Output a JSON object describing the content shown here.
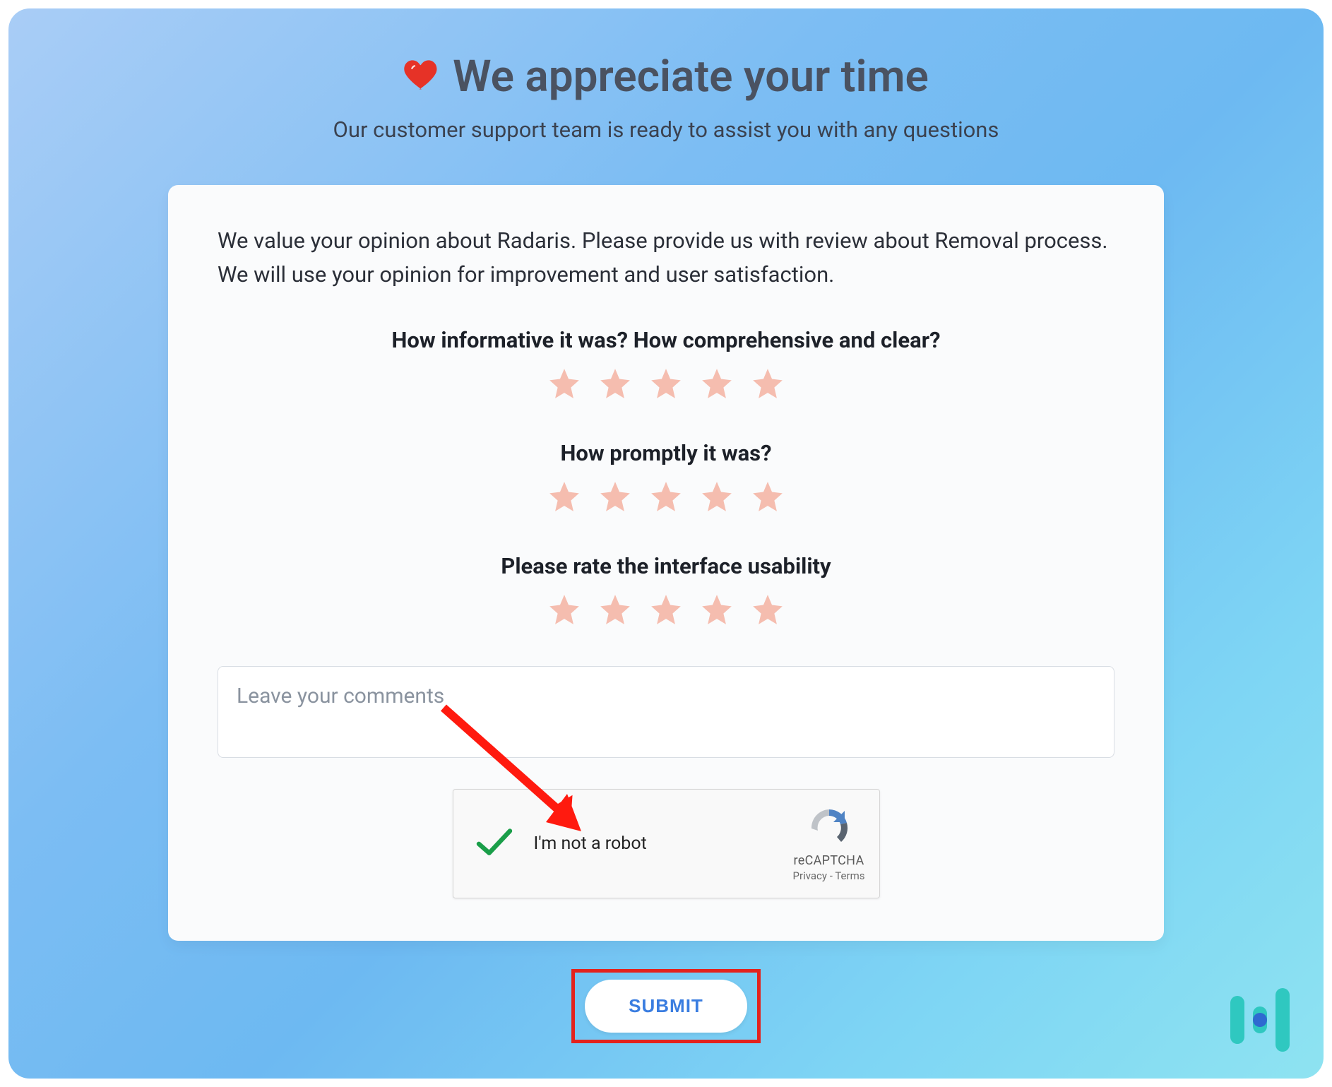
{
  "header": {
    "title": "We appreciate your time",
    "subtitle": "Our customer support team is ready to assist you with any questions"
  },
  "panel": {
    "intro": "We value your opinion about Radaris. Please provide us with review about Removal process. We will use your opinion for improvement and user satisfaction.",
    "questions": [
      "How informative it was? How comprehensive and clear?",
      "How promptly it was?",
      "Please rate the interface usability"
    ],
    "comments_placeholder": "Leave your comments"
  },
  "captcha": {
    "label": "I'm not a robot",
    "brand": "reCAPTCHA",
    "privacy": "Privacy",
    "terms": "Terms"
  },
  "submit_label": "SUBMIT",
  "colors": {
    "star": "#f5bdaf",
    "heart": "#e63227",
    "arrow": "#ff1a0f",
    "highlight_border": "#e3221d",
    "submit_text": "#3a7de0"
  }
}
